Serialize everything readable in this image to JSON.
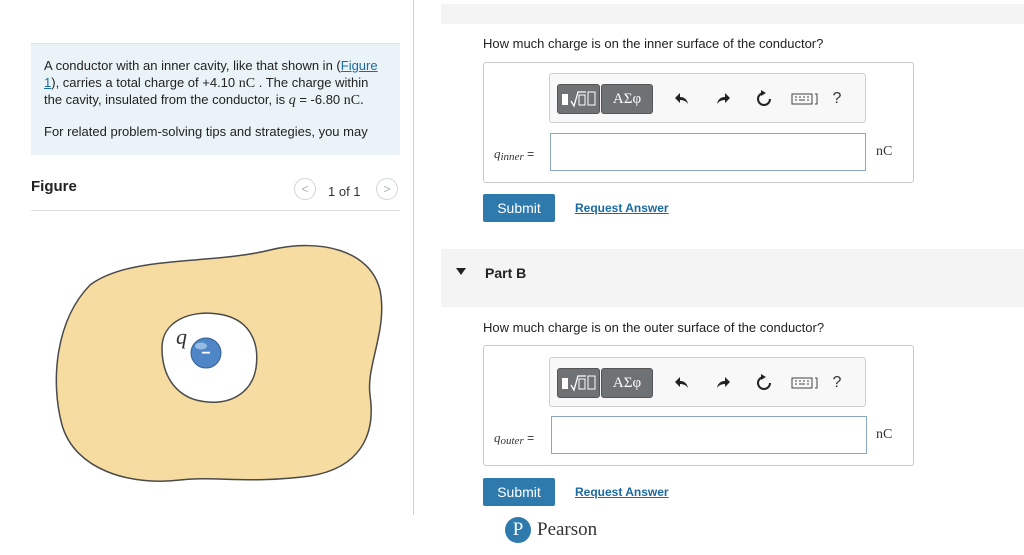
{
  "problem": {
    "sentence_start": "A conductor with an inner cavity, like that shown in (",
    "figure_link": "Figure 1",
    "sentence_mid": "), carries a total charge of +4.10 ",
    "unit_nC": "nC",
    "sentence_mid2": " . The charge within the cavity, insulated from the conductor, is ",
    "q_symbol": "q",
    "q_value": " = -6.80 ",
    "q_unit": "nC.",
    "tips": "For related problem-solving tips and strategies, you may"
  },
  "figure": {
    "label": "Figure",
    "prev_icon": "<",
    "next_icon": ">",
    "count": "1 of 1",
    "charge_label": "q",
    "charge_sign": "−"
  },
  "part_a": {
    "question": "How much charge is on   the inner surface of the conductor?",
    "var_base": "q",
    "var_sub": "inner",
    "equals": " =",
    "unit": "nC",
    "submit": "Submit",
    "request": "Request Answer",
    "input_value": ""
  },
  "part_b": {
    "label": "Part B",
    "question": "How much charge is on the outer surface of the conductor?",
    "var_base": "q",
    "var_sub": "outer",
    "equals": " =",
    "unit": "nC",
    "submit": "Submit",
    "request": "Request Answer",
    "input_value": ""
  },
  "toolbar": {
    "symbols_label": "ΑΣφ",
    "help": "?"
  },
  "icons": {
    "templates": "math-templates-icon",
    "symbols": "greek-symbols-icon",
    "undo": "undo-icon",
    "redo": "redo-icon",
    "reset": "reset-icon",
    "keyboard": "keyboard-icon",
    "help": "help-icon"
  },
  "footer": {
    "brand": "Pearson",
    "logo_letter": "P"
  },
  "colors": {
    "accent": "#2f7aad",
    "conductor_fill": "#f6dca0",
    "problem_bg": "#eaf4f8",
    "charge": "#4f86c6"
  }
}
